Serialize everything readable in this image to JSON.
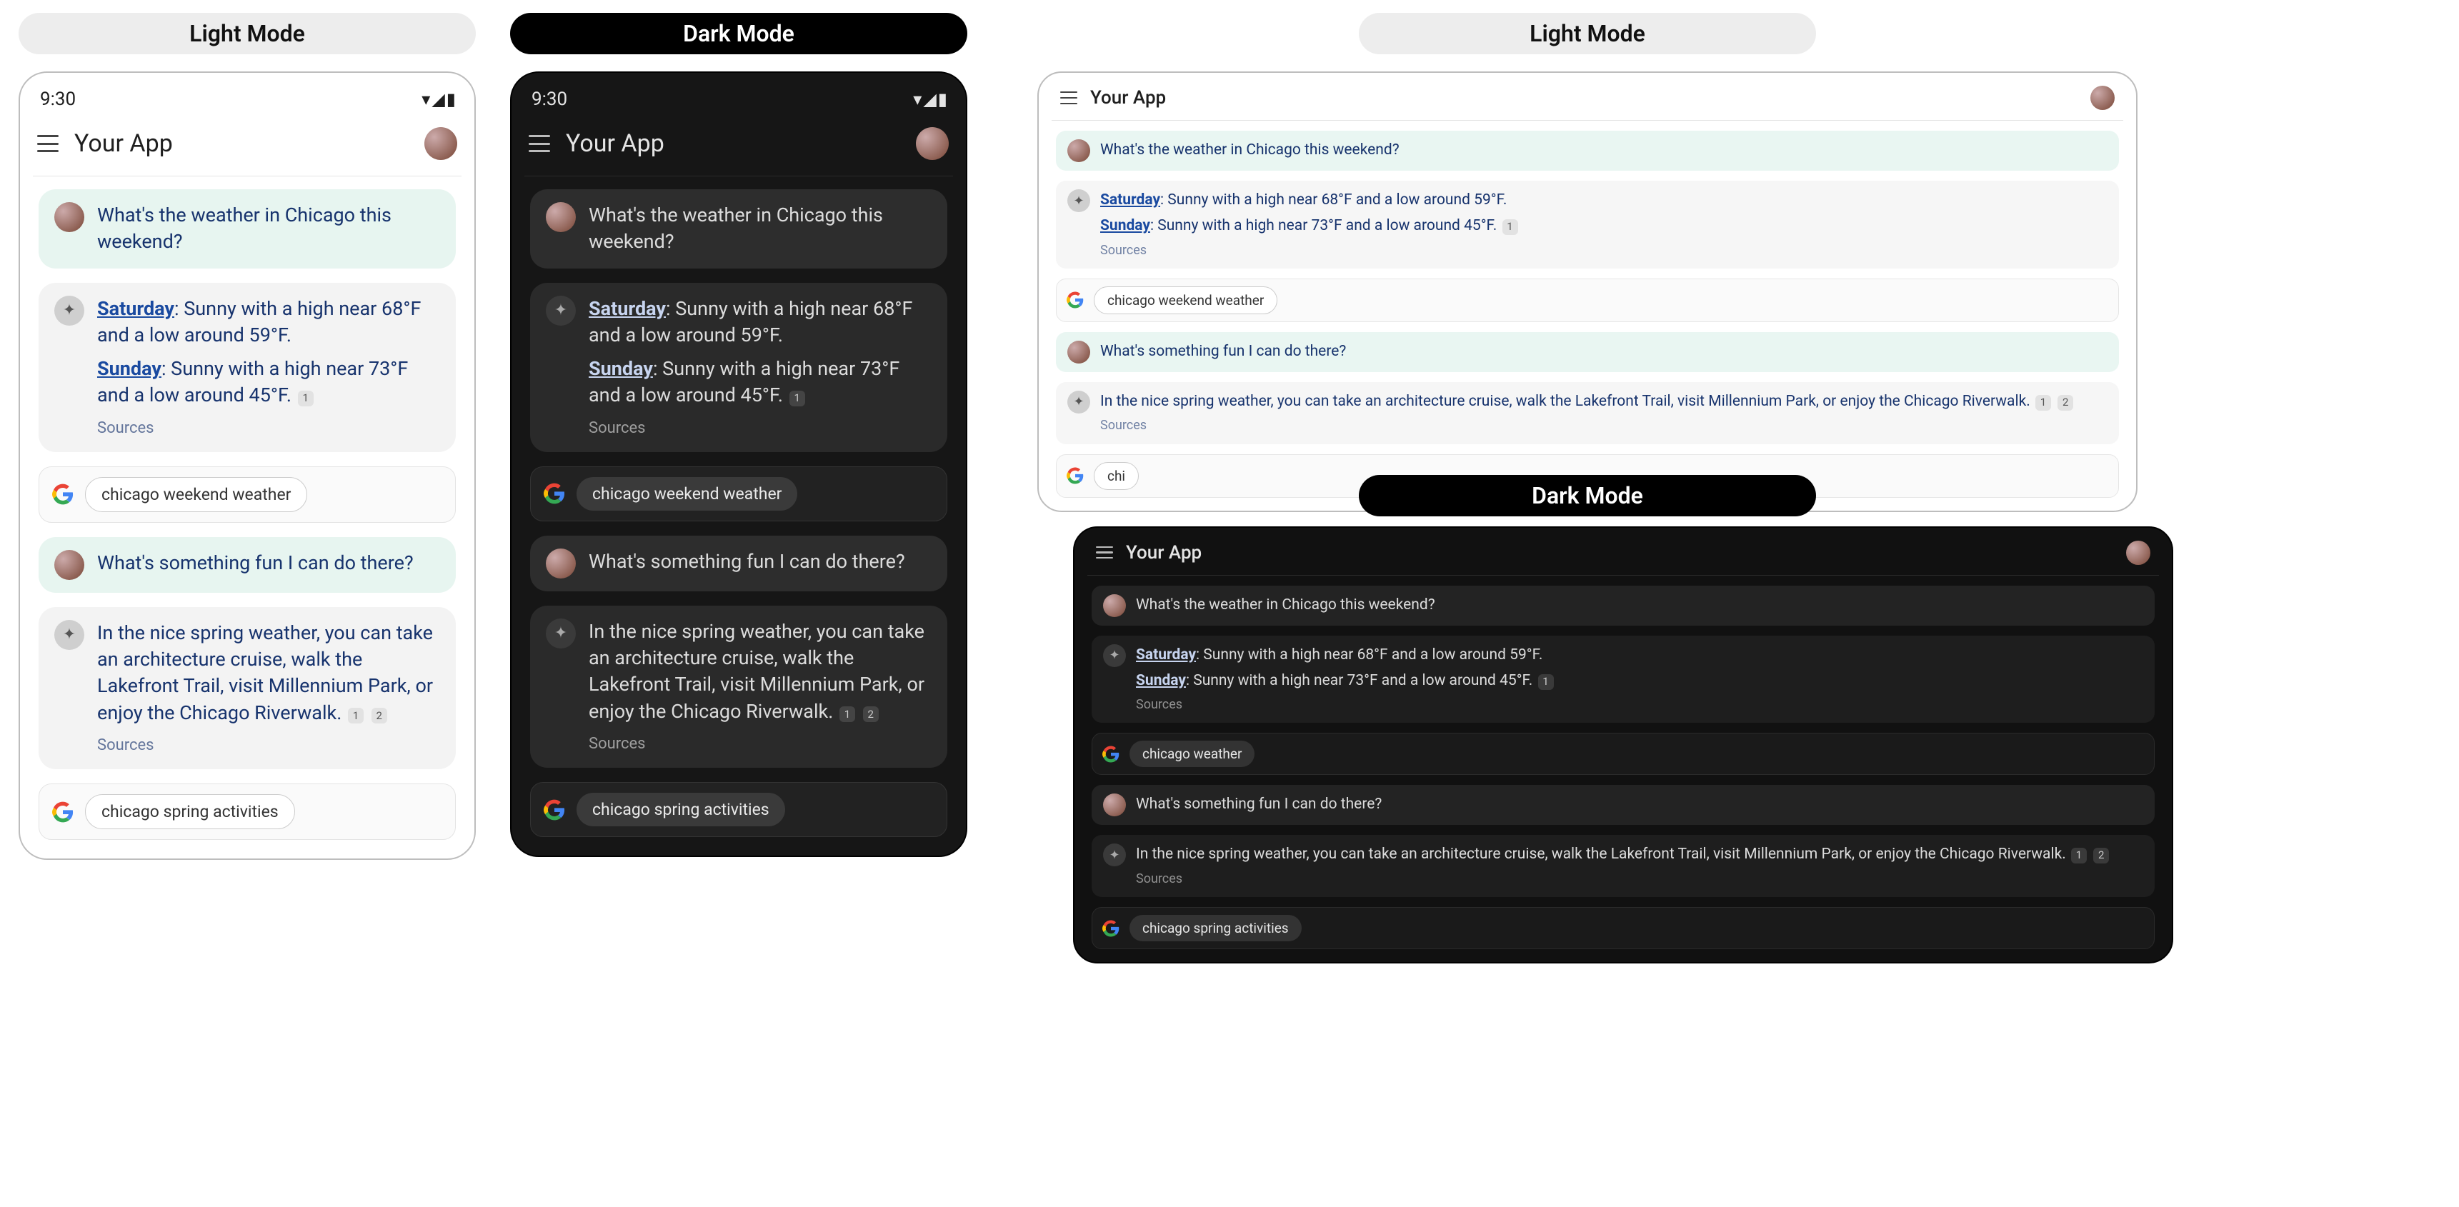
{
  "labels": {
    "light": "Light Mode",
    "dark": "Dark Mode"
  },
  "statusTime": "9:30",
  "appTitle": "Your App",
  "messages": {
    "q1": "What's the weather in Chicago this weekend?",
    "a1_sat_prefix": "Saturday",
    "a1_sat_rest": ": Sunny with a high near 68°F and a low around 59°F.",
    "a1_sun_prefix": "Sunday",
    "a1_sun_rest": ": Sunny with a high near 73°F and a low around 45°F.",
    "sources": "Sources",
    "chip_weather": "chicago weekend weather",
    "chip_weather_short": "chicago weather",
    "q2": "What's something fun I can do there?",
    "a2": "In the nice spring weather, you can take an architecture cruise, walk the Lakefront Trail, visit Millennium Park, or enjoy the Chicago Riverwalk.",
    "chip_activities": "chicago spring activities",
    "chi_partial": "chi"
  },
  "citations": {
    "c1": "1",
    "c2": "2"
  }
}
